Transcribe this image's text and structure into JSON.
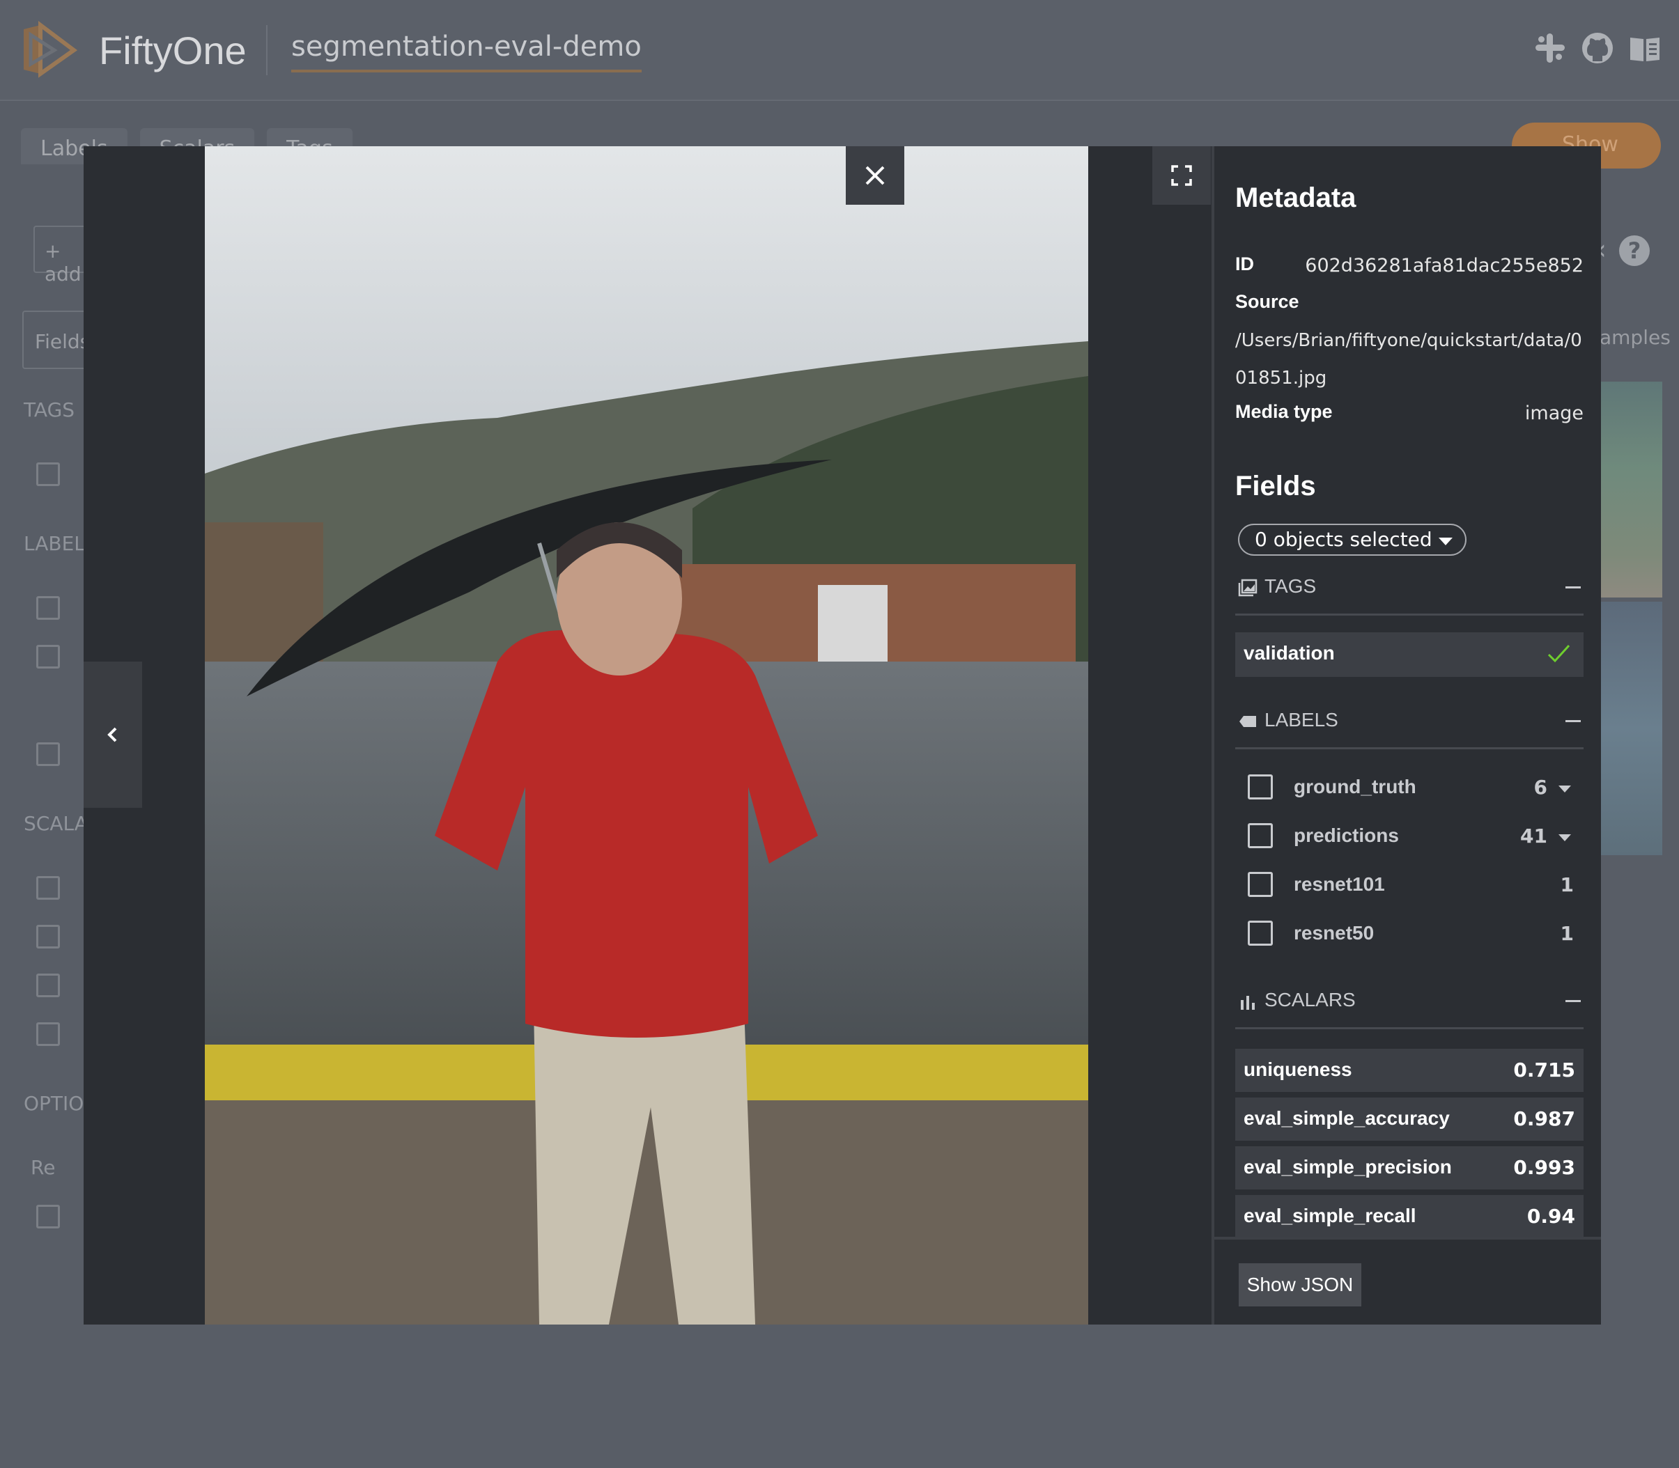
{
  "app": {
    "brand": "FiftyOne",
    "dataset_name": "segmentation-eval-demo",
    "top_icons": [
      "slack-icon",
      "github-icon",
      "docs-book-icon"
    ]
  },
  "background": {
    "tabs": [
      "Labels",
      "Scalars",
      "Tags"
    ],
    "show_button": "Show",
    "add_stage": "+ add",
    "fields_label": "Fields",
    "sections": [
      "TAGS",
      "LABELS",
      "SCALARS",
      "OPTIONS"
    ],
    "refresh_label": "Re",
    "samples_label": "amples"
  },
  "modal": {
    "metadata": {
      "heading": "Metadata",
      "id_label": "ID",
      "id_value": "602d36281afa81dac255e852",
      "source_label": "Source",
      "source_value": "/Users/Brian/fiftyone/quickstart/data/001851.jpg",
      "media_type_label": "Media type",
      "media_type_value": "image"
    },
    "fields": {
      "heading": "Fields",
      "objects_selected": "0 objects selected",
      "tags_section": "TAGS",
      "tags": [
        {
          "name": "validation",
          "checked": true
        }
      ],
      "labels_section": "LABELS",
      "labels": [
        {
          "name": "ground_truth",
          "count": "6",
          "expandable": true
        },
        {
          "name": "predictions",
          "count": "41",
          "expandable": true
        },
        {
          "name": "resnet101",
          "count": "1",
          "expandable": false
        },
        {
          "name": "resnet50",
          "count": "1",
          "expandable": false
        }
      ],
      "scalars_section": "SCALARS",
      "scalars": [
        {
          "name": "uniqueness",
          "value": "0.715"
        },
        {
          "name": "eval_simple_accuracy",
          "value": "0.987"
        },
        {
          "name": "eval_simple_precision",
          "value": "0.993"
        },
        {
          "name": "eval_simple_recall",
          "value": "0.94"
        }
      ]
    },
    "show_json": "Show JSON"
  },
  "colors": {
    "accent_orange": "#e08b3b",
    "check_green": "#6fcf2e",
    "modal_bg": "#2b2e33",
    "row_bg": "#3c3f45"
  }
}
